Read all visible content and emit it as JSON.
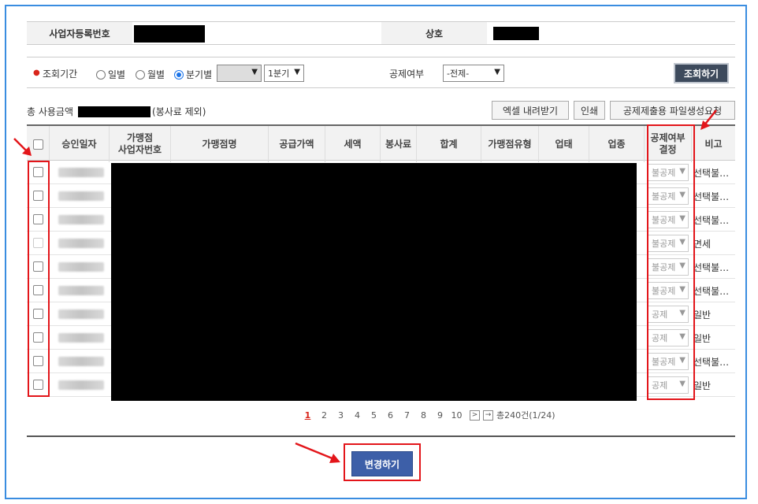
{
  "info": {
    "biz_reg_label": "사업자등록번호",
    "company_label": "상호"
  },
  "filter": {
    "period_label": "조회기간",
    "radios": [
      {
        "label": "일별",
        "selected": false
      },
      {
        "label": "월별",
        "selected": false
      },
      {
        "label": "분기별",
        "selected": true
      }
    ],
    "quarter_value": "1분기",
    "deduction_label": "공제여부",
    "deduction_value": "-전제-",
    "search_button": "조회하기"
  },
  "summary": {
    "total_label": "총 사용금액",
    "excluded_note": "(봉사료 제외)"
  },
  "actions": {
    "excel": "엑셀 내려받기",
    "print": "인쇄",
    "file_request": "공제제출용 파일생성요청"
  },
  "table": {
    "columns": {
      "approval_date": "승인일자",
      "merchant_biz_no_1": "가맹점",
      "merchant_biz_no_2": "사업자번호",
      "merchant_name": "가맹점명",
      "supply_amount": "공급가액",
      "tax": "세액",
      "service_fee": "봉사료",
      "total": "합계",
      "merchant_type": "가맹점유형",
      "business_type": "업태",
      "business_item": "업종",
      "deduction_decision_1": "공제여부",
      "deduction_decision_2": "결정",
      "remarks": "비고"
    },
    "rows": [
      {
        "decision": "불공제",
        "note": "선택불…",
        "checkbox_enabled": true
      },
      {
        "decision": "불공제",
        "note": "선택불…",
        "checkbox_enabled": true
      },
      {
        "decision": "불공제",
        "note": "선택불…",
        "checkbox_enabled": true
      },
      {
        "decision": "불공제",
        "note": "면세",
        "checkbox_enabled": false
      },
      {
        "decision": "불공제",
        "note": "선택불…",
        "checkbox_enabled": true
      },
      {
        "decision": "불공제",
        "note": "선택불…",
        "checkbox_enabled": true
      },
      {
        "decision": "공제",
        "note": "일반",
        "checkbox_enabled": true
      },
      {
        "decision": "공제",
        "note": "일반",
        "checkbox_enabled": true
      },
      {
        "decision": "불공제",
        "note": "선택불…",
        "checkbox_enabled": true
      },
      {
        "decision": "공제",
        "note": "일반",
        "checkbox_enabled": true
      }
    ]
  },
  "pagination": {
    "pages": [
      "1",
      "2",
      "3",
      "4",
      "5",
      "6",
      "7",
      "8",
      "9",
      "10"
    ],
    "current": "1",
    "total_text": "총240건(1/24)"
  },
  "change_button": "변경하기"
}
